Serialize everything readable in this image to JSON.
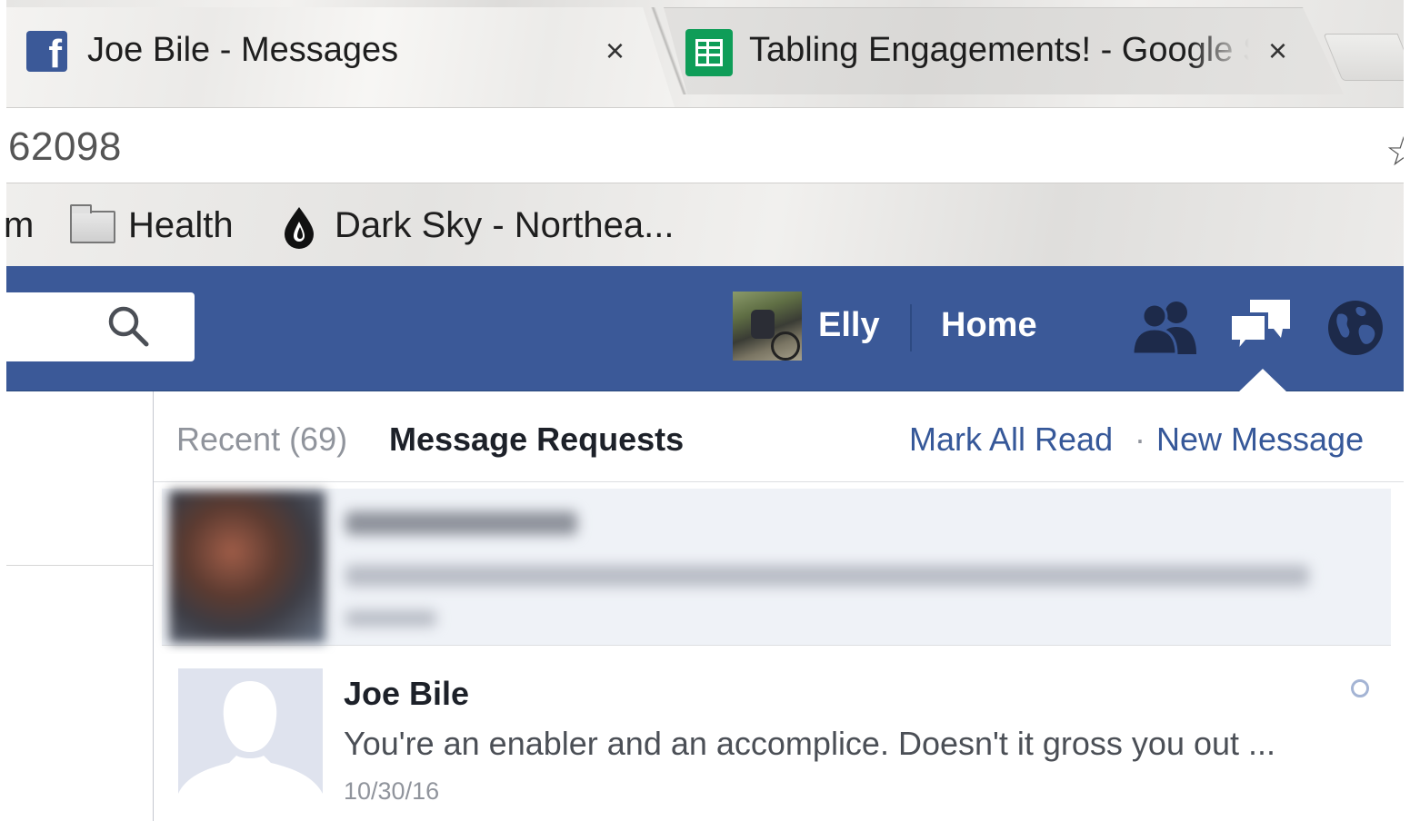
{
  "browser": {
    "tabs": [
      {
        "title": "Joe Bile - Messages",
        "favicon": "facebook-icon",
        "active": true,
        "close_label": "×"
      },
      {
        "title": "Tabling Engagements! - Google Sheets",
        "favicon": "google-sheets-icon",
        "active": false,
        "close_label": "×"
      }
    ],
    "address_bar": {
      "url_fragment": "62098",
      "star_icon": "☆"
    },
    "bookmarks": [
      {
        "label": "m",
        "icon": null
      },
      {
        "label": "Health",
        "icon": "folder-icon"
      },
      {
        "label": "Dark Sky - Northea...",
        "icon": "dark-sky-icon"
      }
    ]
  },
  "facebook": {
    "brand_color": "#3b5998",
    "navbar": {
      "user_name": "Elly",
      "home_label": "Home",
      "icons": [
        "friend-requests-icon",
        "messages-icon",
        "notifications-globe-icon"
      ]
    },
    "messages_dropdown": {
      "tabs": [
        {
          "label": "Recent (69)",
          "selected": false
        },
        {
          "label": "Message Requests",
          "selected": true
        }
      ],
      "actions": {
        "mark_all_read": "Mark All Read",
        "separator": "·",
        "new_message": "New Message"
      },
      "threads": [
        {
          "name": "Joe Bile",
          "snippet": "You're an enabler and an accomplice. Doesn't it gross you out ...",
          "date": "10/30/16",
          "unread_marker": "unread-dot-icon"
        }
      ]
    }
  }
}
